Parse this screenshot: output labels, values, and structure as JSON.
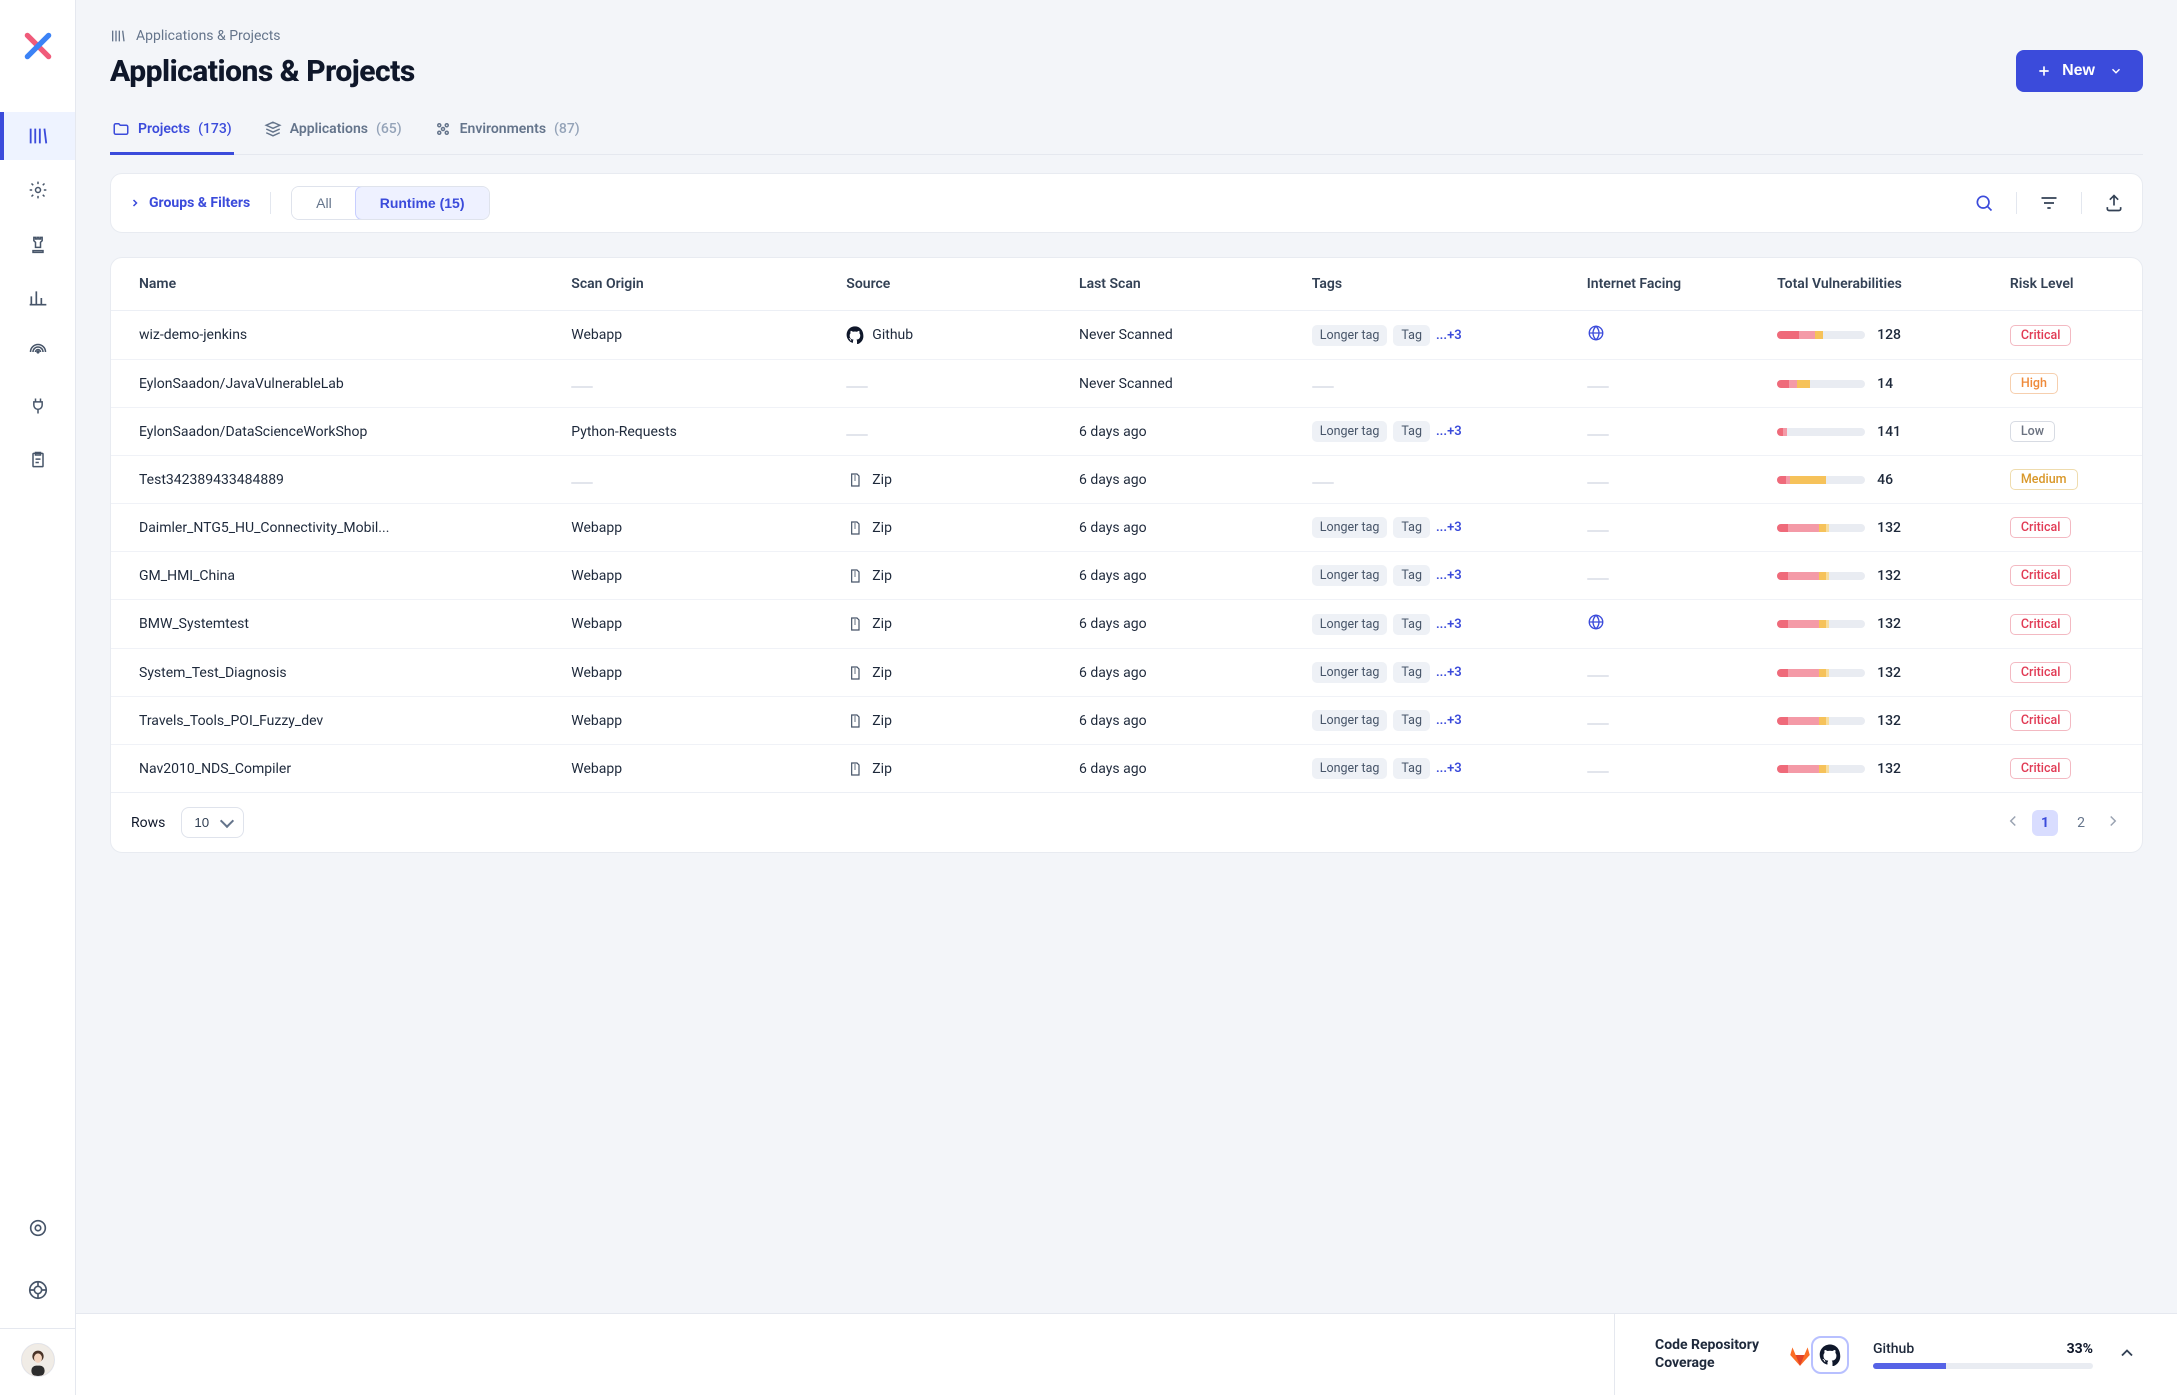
{
  "breadcrumb": "Applications & Projects",
  "page_title": "Applications & Projects",
  "new_button": "New",
  "tabs": [
    {
      "label": "Projects",
      "count": "(173)",
      "active": true
    },
    {
      "label": "Applications",
      "count": "(65)",
      "active": false
    },
    {
      "label": "Environments",
      "count": "(87)",
      "active": false
    }
  ],
  "groups_filters": "Groups & Filters",
  "seg_all": "All",
  "seg_runtime": "Runtime (15)",
  "columns": {
    "name": "Name",
    "origin": "Scan Origin",
    "source": "Source",
    "last": "Last Scan",
    "tags": "Tags",
    "net": "Internet Facing",
    "vuln": "Total Vulnerabilities",
    "risk": "Risk Level"
  },
  "tag_labels": {
    "longer": "Longer tag",
    "short": "Tag",
    "more": "...+3"
  },
  "rows": [
    {
      "name": "wiz-demo-jenkins",
      "origin": "Webapp",
      "source": "Github",
      "source_type": "github",
      "last": "Never Scanned",
      "tags": true,
      "net": true,
      "vuln": 128,
      "bars": [
        25,
        18,
        9,
        0
      ],
      "risk": "Critical",
      "risk_cls": "critical"
    },
    {
      "name": "EylonSaadon/JavaVulnerableLab",
      "origin": "",
      "source": "",
      "source_type": "",
      "last": "Never Scanned",
      "tags": false,
      "net": false,
      "vuln": 14,
      "bars": [
        14,
        9,
        14,
        0
      ],
      "risk": "High",
      "risk_cls": "high"
    },
    {
      "name": "EylonSaadon/DataScienceWorkShop",
      "origin": "Python-Requests",
      "source": "",
      "source_type": "",
      "last": "6 days ago",
      "tags": true,
      "net": false,
      "vuln": 141,
      "bars": [
        7,
        4,
        0,
        0
      ],
      "risk": "Low",
      "risk_cls": "low"
    },
    {
      "name": "Test342389433484889",
      "origin": "",
      "source": "Zip",
      "source_type": "zip",
      "last": "6 days ago",
      "tags": false,
      "net": false,
      "vuln": 46,
      "bars": [
        10,
        5,
        40,
        0
      ],
      "risk": "Medium",
      "risk_cls": "medium"
    },
    {
      "name": "Daimler_NTG5_HU_Connectivity_Mobil...",
      "origin": "Webapp",
      "source": "Zip",
      "source_type": "zip",
      "last": "6 days ago",
      "tags": true,
      "net": false,
      "vuln": 132,
      "bars": [
        12,
        36,
        7,
        4
      ],
      "risk": "Critical",
      "risk_cls": "critical"
    },
    {
      "name": "GM_HMI_China",
      "origin": "Webapp",
      "source": "Zip",
      "source_type": "zip",
      "last": "6 days ago",
      "tags": true,
      "net": false,
      "vuln": 132,
      "bars": [
        12,
        36,
        7,
        4
      ],
      "risk": "Critical",
      "risk_cls": "critical"
    },
    {
      "name": "BMW_Systemtest",
      "origin": "Webapp",
      "source": "Zip",
      "source_type": "zip",
      "last": "6 days ago",
      "tags": true,
      "net": true,
      "vuln": 132,
      "bars": [
        12,
        36,
        7,
        4
      ],
      "risk": "Critical",
      "risk_cls": "critical"
    },
    {
      "name": "System_Test_Diagnosis",
      "origin": "Webapp",
      "source": "Zip",
      "source_type": "zip",
      "last": "6 days ago",
      "tags": true,
      "net": false,
      "vuln": 132,
      "bars": [
        12,
        36,
        7,
        4
      ],
      "risk": "Critical",
      "risk_cls": "critical"
    },
    {
      "name": "Travels_Tools_POI_Fuzzy_dev",
      "origin": "Webapp",
      "source": "Zip",
      "source_type": "zip",
      "last": "6 days ago",
      "tags": true,
      "net": false,
      "vuln": 132,
      "bars": [
        12,
        36,
        7,
        4
      ],
      "risk": "Critical",
      "risk_cls": "critical"
    },
    {
      "name": "Nav2010_NDS_Compiler",
      "origin": "Webapp",
      "source": "Zip",
      "source_type": "zip",
      "last": "6 days ago",
      "tags": true,
      "net": false,
      "vuln": 132,
      "bars": [
        12,
        36,
        7,
        4
      ],
      "risk": "Critical",
      "risk_cls": "critical"
    }
  ],
  "rows_label": "Rows",
  "rows_per_page": "10",
  "pages": [
    "1",
    "2"
  ],
  "coverage": {
    "title_line1": "Code Repository",
    "title_line2": "Coverage",
    "provider": "Github",
    "pct": "33%",
    "pct_num": 33
  }
}
